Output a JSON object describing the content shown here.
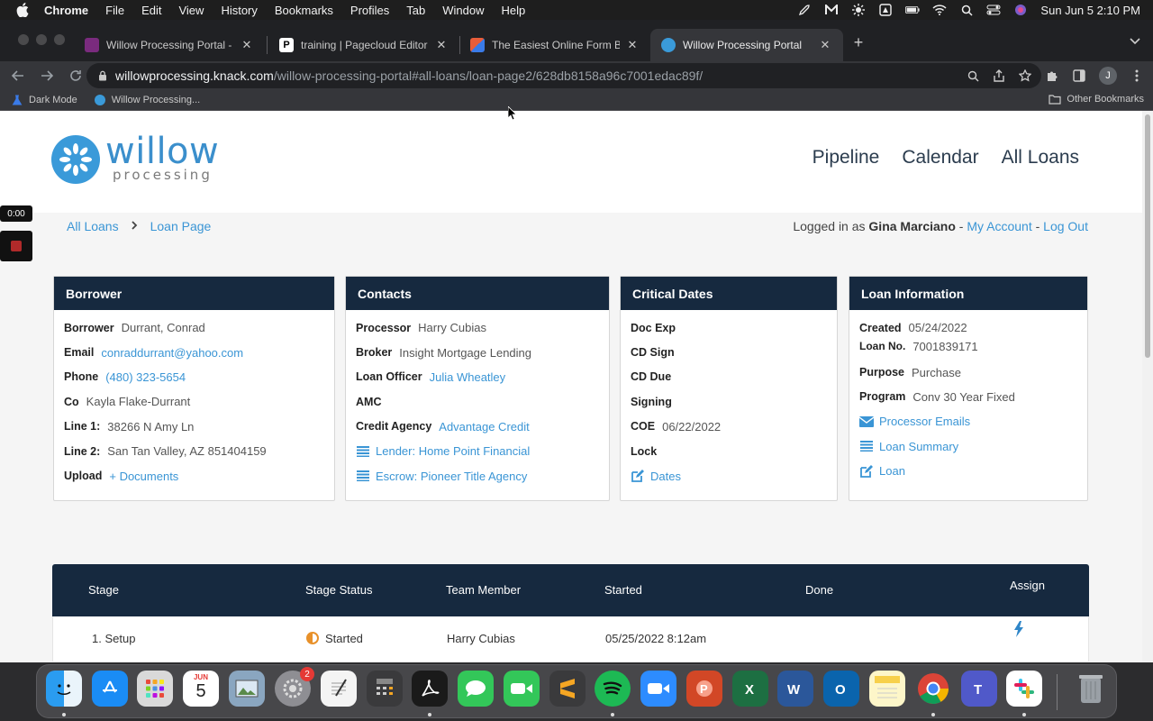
{
  "menubar": {
    "app": "Chrome",
    "items": [
      "File",
      "Edit",
      "View",
      "History",
      "Bookmarks",
      "Profiles",
      "Tab",
      "Window",
      "Help"
    ],
    "clock": "Sun Jun 5  2:10 PM"
  },
  "tabs": [
    {
      "label": "Willow Processing Portal - Knack",
      "favicon_color": "#7a2b7e"
    },
    {
      "label": "training | Pagecloud Editor",
      "favicon_color": "#ffffff"
    },
    {
      "label": "The Easiest Online Form Builder",
      "favicon_color": "#e85d3a"
    },
    {
      "label": "Willow Processing Portal",
      "favicon_color": "#3a9ad9"
    }
  ],
  "address": {
    "domain": "willowprocessing.knack.com",
    "path": "/willow-processing-portal#all-loans/loan-page2/628db8158a96c7001edac89f/"
  },
  "bookmarks": {
    "items": [
      "Dark Mode",
      "Willow Processing..."
    ],
    "other": "Other Bookmarks"
  },
  "profile_initial": "J",
  "site": {
    "logo_word": "willow",
    "logo_sub": "processing",
    "nav": [
      "Pipeline",
      "Calendar",
      "All Loans"
    ]
  },
  "breadcrumb": {
    "root": "All Loans",
    "current": "Loan Page"
  },
  "login": {
    "prefix": "Logged in as",
    "user": "Gina Marciano",
    "sep": "-",
    "account": "My Account",
    "logout": "Log Out"
  },
  "borrower": {
    "title": "Borrower",
    "borrower_label": "Borrower",
    "borrower_value": "Durrant, Conrad",
    "email_label": "Email",
    "email_value": "conraddurrant@yahoo.com",
    "phone_label": "Phone",
    "phone_value": "(480) 323-5654",
    "co_label": "Co",
    "co_value": "Kayla Flake-Durrant",
    "line1_label": "Line 1:",
    "line1_value": "38266 N Amy Ln",
    "line2_label": "Line 2:",
    "line2_value": "San Tan Valley, AZ 851404159",
    "upload_label": "Upload",
    "upload_value": "+ Documents"
  },
  "contacts": {
    "title": "Contacts",
    "processor_label": "Processor",
    "processor_value": "Harry Cubias",
    "broker_label": "Broker",
    "broker_value": "Insight Mortgage Lending",
    "officer_label": "Loan Officer",
    "officer_value": "Julia Wheatley",
    "amc_label": "AMC",
    "credit_label": "Credit Agency",
    "credit_value": "Advantage Credit",
    "lender_link": "Lender: Home Point Financial",
    "escrow_link": "Escrow: Pioneer Title Agency"
  },
  "dates": {
    "title": "Critical Dates",
    "doc_exp": "Doc Exp",
    "cd_sign": "CD Sign",
    "cd_due": "CD Due",
    "signing": "Signing",
    "coe_label": "COE",
    "coe_value": "06/22/2022",
    "lock": "Lock",
    "dates_link": "Dates"
  },
  "loan": {
    "title": "Loan Information",
    "created_label": "Created",
    "created_value": "05/24/2022",
    "loanno_label": "Loan No.",
    "loanno_value": "7001839171",
    "purpose_label": "Purpose",
    "purpose_value": "Purchase",
    "program_label": "Program",
    "program_value": "Conv 30 Year Fixed",
    "emails_link": "Processor Emails",
    "summary_link": "Loan Summary",
    "loan_link": "Loan"
  },
  "stages": {
    "headers": [
      "Stage",
      "Stage Status",
      "Team Member",
      "Started",
      "Done",
      "Assign"
    ],
    "rows": [
      {
        "stage": "1. Setup",
        "status": "Started",
        "member": "Harry Cubias",
        "started": "05/25/2022 8:12am",
        "done": ""
      }
    ]
  },
  "recorder": {
    "time": "0:00"
  },
  "dock": {
    "calendar_month": "JUN",
    "calendar_day": "5",
    "settings_badge": "2"
  },
  "colors": {
    "card_header": "#16293f",
    "link": "#3a95d5",
    "brand": "#3a9ad9"
  }
}
